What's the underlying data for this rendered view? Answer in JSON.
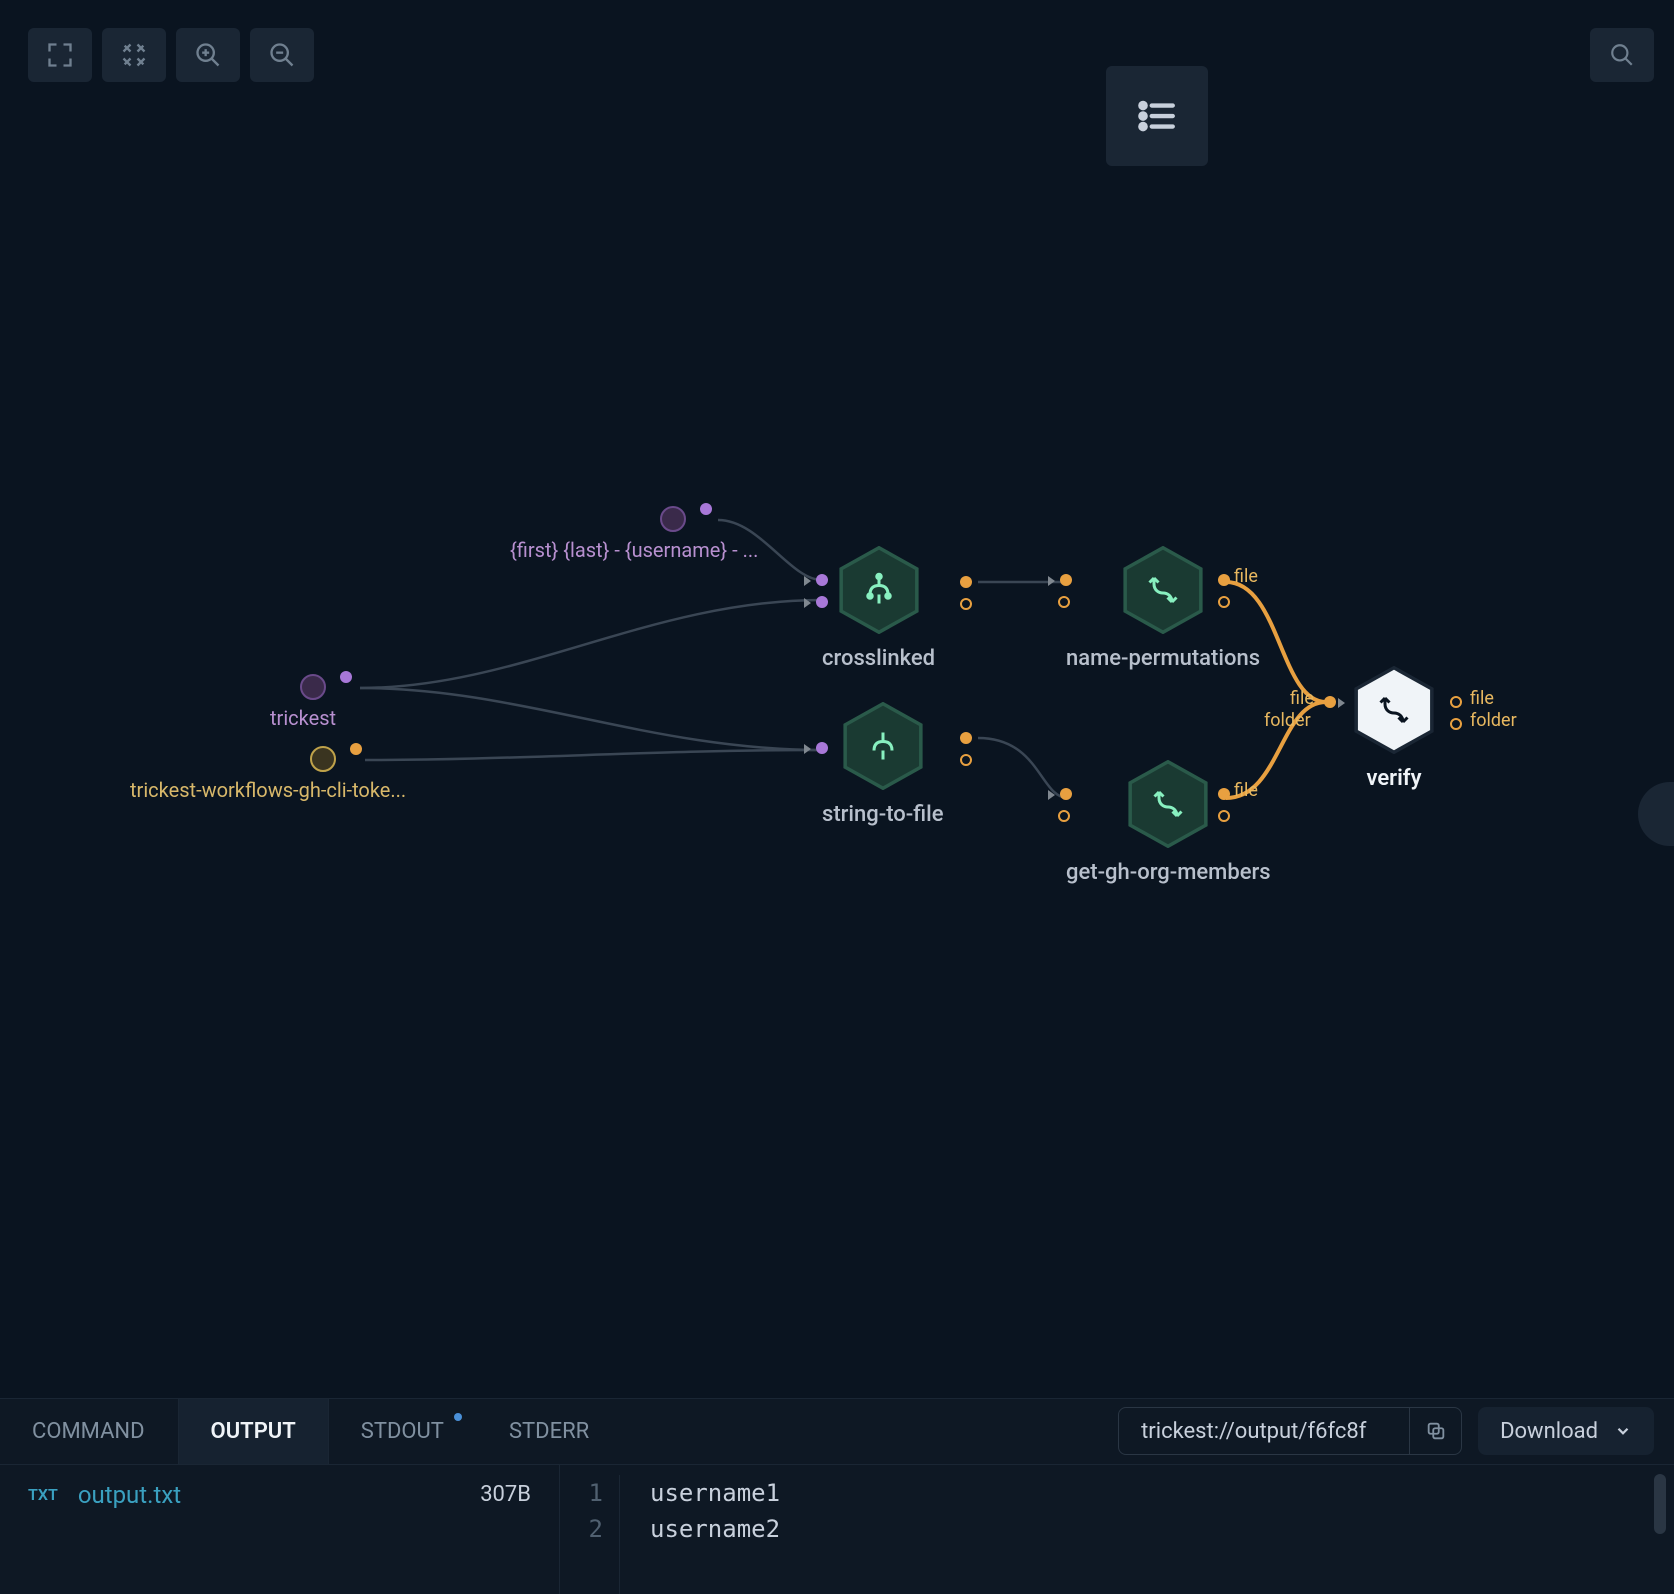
{
  "toolbar": {
    "fullscreen_icon": "fullscreen",
    "fit_icon": "fit-screen",
    "zoom_in_icon": "zoom-in",
    "zoom_out_icon": "zoom-out",
    "search_icon": "search",
    "list_icon": "list"
  },
  "nodes": {
    "param_template": {
      "label": "{first} {last} - {username} - ..."
    },
    "param_trickest": {
      "label": "trickest"
    },
    "param_token": {
      "label": "trickest-workflows-gh-cli-toke..."
    },
    "crosslinked": {
      "title": "crosslinked"
    },
    "string_to_file": {
      "title": "string-to-file"
    },
    "name_permutations": {
      "title": "name-permutations",
      "out_label": "file"
    },
    "get_gh_org_members": {
      "title": "get-gh-org-members",
      "out_label": "file"
    },
    "verify": {
      "title": "verify",
      "in_file_label": "file",
      "in_folder_label": "folder",
      "out_file_label": "file",
      "out_folder_label": "folder"
    }
  },
  "tabs": {
    "command": "COMMAND",
    "output": "OUTPUT",
    "stdout": "STDOUT",
    "stderr": "STDERR"
  },
  "output_path": "trickest://output/f6fc8f",
  "download_label": "Download",
  "file": {
    "badge": "TXT",
    "name": "output.txt",
    "size": "307B"
  },
  "code": {
    "lines": [
      "username1",
      "username2"
    ],
    "line_numbers": [
      "1",
      "2"
    ]
  }
}
